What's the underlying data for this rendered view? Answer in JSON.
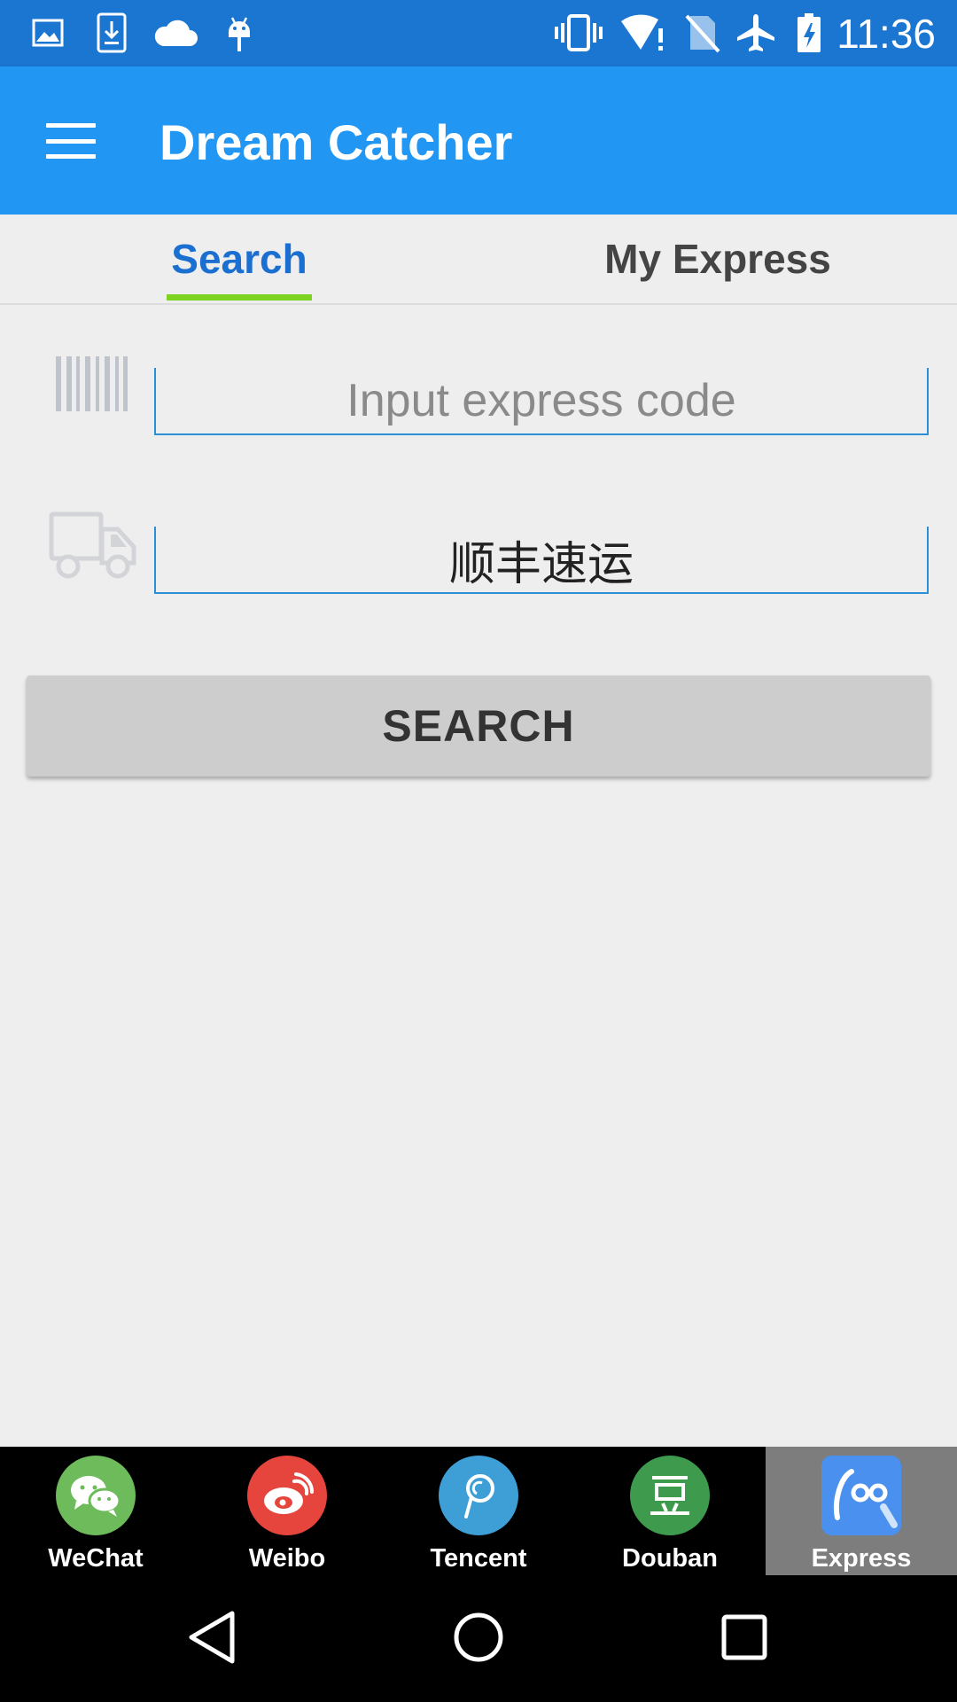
{
  "status_bar": {
    "time": "11:36",
    "left_icons": [
      "image-icon",
      "download-icon",
      "cloud-icon",
      "android-icon"
    ],
    "right_icons": [
      "vibrate-icon",
      "wifi-icon",
      "no-sim-icon",
      "airplane-icon",
      "battery-icon"
    ]
  },
  "app_bar": {
    "title": "Dream Catcher",
    "menu_icon": "hamburger-menu-icon",
    "color": "#2196f3"
  },
  "tabs": [
    {
      "label": "Search",
      "active": true
    },
    {
      "label": "My Express",
      "active": false
    }
  ],
  "form": {
    "code_input": {
      "placeholder": "Input express code",
      "value": ""
    },
    "courier_input": {
      "value": "顺丰速运"
    },
    "search_button": "SEARCH"
  },
  "bottom_nav": [
    {
      "label": "WeChat",
      "color": "#6dbb5b",
      "icon": "wechat-icon"
    },
    {
      "label": "Weibo",
      "color": "#e5453c",
      "icon": "weibo-icon"
    },
    {
      "label": "Tencent",
      "color": "#3e9ed6",
      "icon": "tencent-icon"
    },
    {
      "label": "Douban",
      "color": "#3e9b4e",
      "icon": "douban-icon"
    },
    {
      "label": "Express",
      "color": "#3a86e8",
      "icon": "express-icon",
      "selected": true
    }
  ]
}
